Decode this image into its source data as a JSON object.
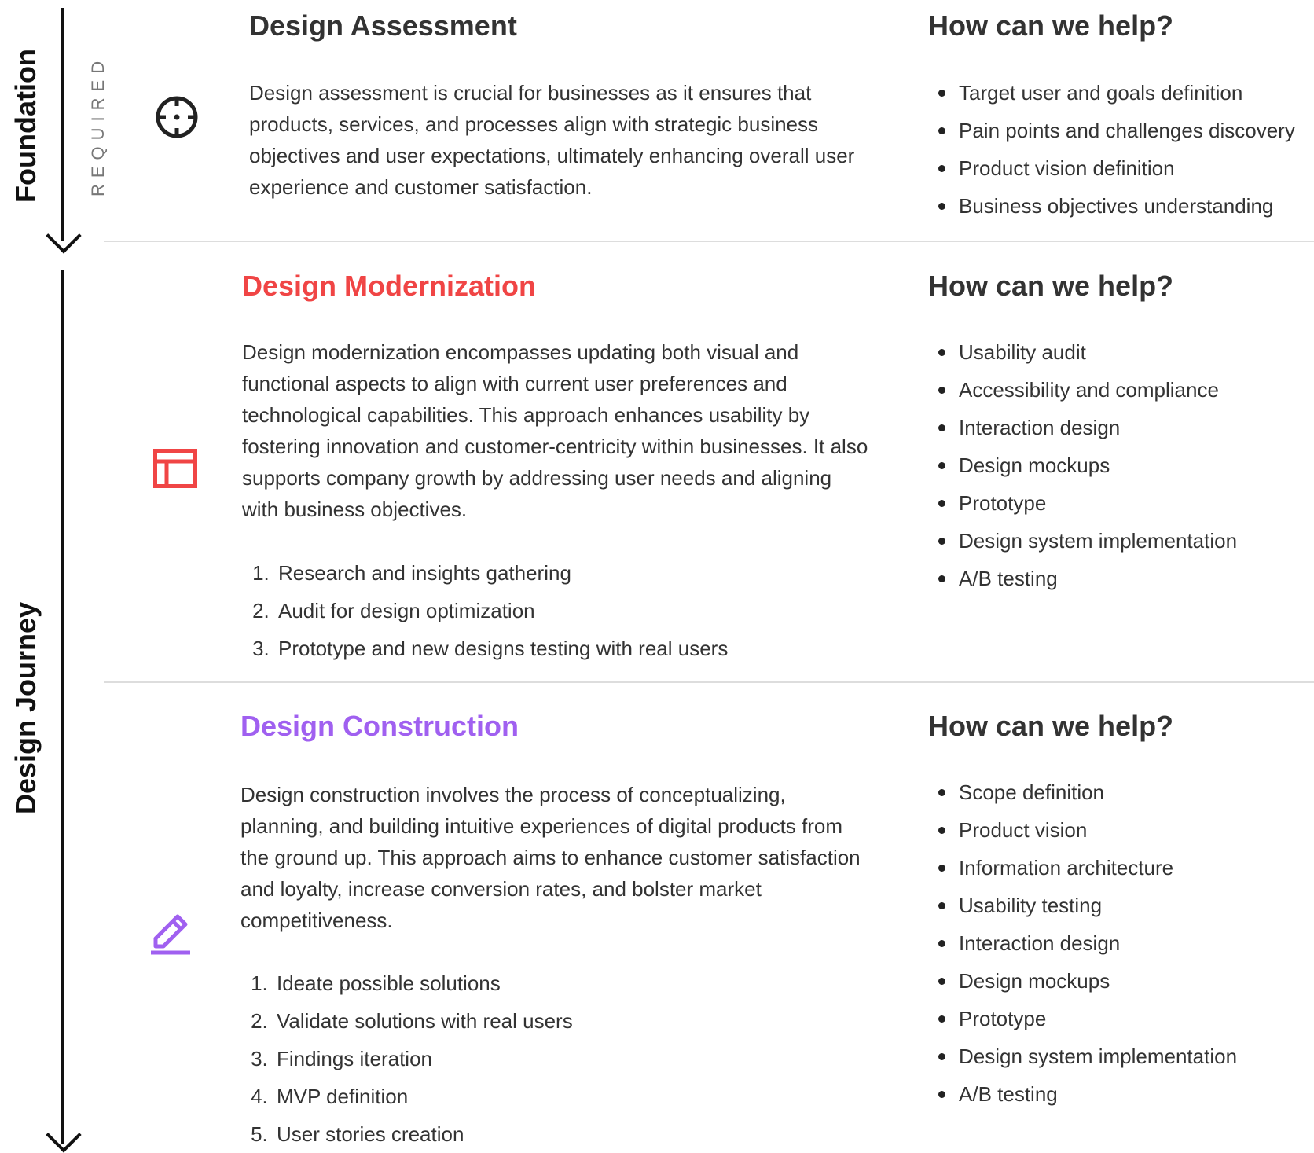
{
  "timeline": {
    "foundation_label": "Foundation",
    "required_label": "REQUIRED",
    "journey_label": "Design Journey"
  },
  "colors": {
    "assessment": "#333333",
    "modernization": "#f04545",
    "construction": "#a060f0"
  },
  "sections": [
    {
      "title": "Design Assessment",
      "icon": "crosshair-icon",
      "description": "Design assessment is crucial for businesses as it ensures that products, services, and processes align with strategic business objectives and user expectations, ultimately enhancing overall user experience and customer satisfaction.",
      "steps": [],
      "help_title": "How can we help?",
      "help_items": [
        "Target user and goals definition",
        "Pain points and challenges discovery",
        "Product vision definition",
        "Business objectives understanding"
      ]
    },
    {
      "title": "Design Modernization",
      "icon": "layout-icon",
      "description": "Design modernization encompasses updating both visual and functional aspects to align with current user preferences and technological capabilities. This approach enhances usability by fostering innovation and customer-centricity within businesses. It also supports company growth by addressing user needs and aligning with business objectives.",
      "steps": [
        "Research and insights gathering",
        "Audit for design optimization",
        "Prototype and new designs testing with real users"
      ],
      "help_title": "How can we help?",
      "help_items": [
        "Usability audit",
        "Accessibility and compliance",
        "Interaction design",
        "Design mockups",
        "Prototype",
        "Design system implementation",
        "A/B testing"
      ]
    },
    {
      "title": "Design Construction",
      "icon": "pencil-icon",
      "description": "Design construction involves the process of conceptualizing, planning, and building intuitive experiences of digital products from the ground up. This approach aims to enhance customer satisfaction and loyalty, increase conversion rates, and bolster market competitiveness.",
      "steps": [
        "Ideate possible solutions",
        "Validate solutions with real users",
        "Findings iteration",
        "MVP definition",
        "User stories creation"
      ],
      "help_title": "How can we help?",
      "help_items": [
        "Scope definition",
        "Product vision",
        "Information architecture",
        "Usability testing",
        "Interaction design",
        "Design mockups",
        "Prototype",
        "Design system implementation",
        "A/B testing"
      ]
    }
  ]
}
